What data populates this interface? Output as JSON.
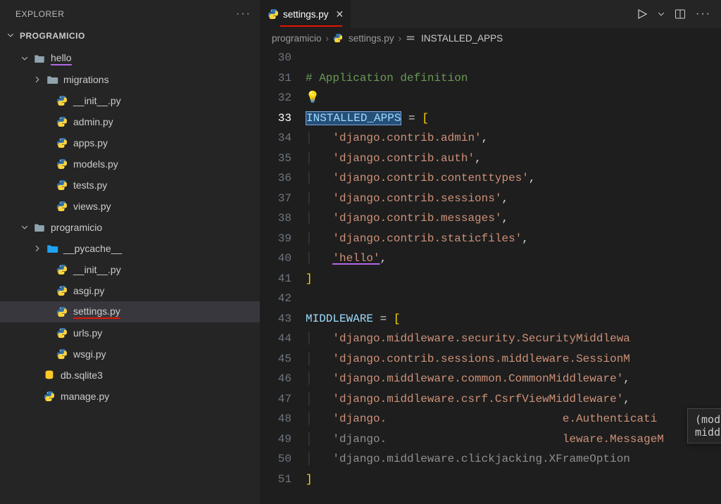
{
  "sidebar": {
    "title": "EXPLORER",
    "root": "PROGRAMICIO",
    "items": [
      {
        "name": "hello",
        "kind": "folder",
        "indent": 0,
        "open": true,
        "hl": "purple"
      },
      {
        "name": "migrations",
        "kind": "folder",
        "indent": 1,
        "open": false
      },
      {
        "name": "__init__.py",
        "kind": "py",
        "indent": 2
      },
      {
        "name": "admin.py",
        "kind": "py",
        "indent": 2
      },
      {
        "name": "apps.py",
        "kind": "py",
        "indent": 2
      },
      {
        "name": "models.py",
        "kind": "py",
        "indent": 2
      },
      {
        "name": "tests.py",
        "kind": "py",
        "indent": 2
      },
      {
        "name": "views.py",
        "kind": "py",
        "indent": 2
      },
      {
        "name": "programicio",
        "kind": "folder",
        "indent": 0,
        "open": true
      },
      {
        "name": "__pycache__",
        "kind": "pyfolder",
        "indent": 1,
        "open": false
      },
      {
        "name": "__init__.py",
        "kind": "py",
        "indent": 2
      },
      {
        "name": "asgi.py",
        "kind": "py",
        "indent": 2
      },
      {
        "name": "settings.py",
        "kind": "py",
        "indent": 2,
        "active": true,
        "hl": "red"
      },
      {
        "name": "urls.py",
        "kind": "py",
        "indent": 2
      },
      {
        "name": "wsgi.py",
        "kind": "py",
        "indent": 2
      },
      {
        "name": "db.sqlite3",
        "kind": "db",
        "indent": 1
      },
      {
        "name": "manage.py",
        "kind": "py",
        "indent": 1
      }
    ]
  },
  "tab": {
    "label": "settings.py"
  },
  "breadcrumb": {
    "segments": [
      "programicio",
      "settings.py",
      "INSTALLED_APPS"
    ]
  },
  "tooltip": {
    "kind": "(module)",
    "name": "middleware"
  },
  "code": {
    "first_line_no": 30,
    "current_line_no": 33,
    "lines": [
      {
        "t": "blank"
      },
      {
        "t": "comment",
        "text": "# Application definition"
      },
      {
        "t": "bulb"
      },
      {
        "t": "assign_open",
        "var": "INSTALLED_APPS",
        "sel": true
      },
      {
        "t": "string_item",
        "text": "'django.contrib.admin'",
        "comma": true
      },
      {
        "t": "string_item",
        "text": "'django.contrib.auth'",
        "comma": true
      },
      {
        "t": "string_item",
        "text": "'django.contrib.contenttypes'",
        "comma": true
      },
      {
        "t": "string_item",
        "text": "'django.contrib.sessions'",
        "comma": true
      },
      {
        "t": "string_item",
        "text": "'django.contrib.messages'",
        "comma": true
      },
      {
        "t": "string_item",
        "text": "'django.contrib.staticfiles'",
        "comma": true
      },
      {
        "t": "string_item",
        "text": "'hello'",
        "comma": true,
        "hl": "purple"
      },
      {
        "t": "close_bracket"
      },
      {
        "t": "blank"
      },
      {
        "t": "assign_open",
        "var": "MIDDLEWARE"
      },
      {
        "t": "string_item",
        "text": "'django.middleware.security.SecurityMiddlewa",
        "comma": false
      },
      {
        "t": "string_item",
        "text": "'django.contrib.sessions.middleware.SessionM",
        "comma": false
      },
      {
        "t": "string_item",
        "text": "'django.middleware.common.CommonMiddleware'",
        "comma": true
      },
      {
        "t": "string_item",
        "text": "'django.middleware.csrf.CsrfViewMiddleware'",
        "comma": true
      },
      {
        "t": "string_item_obscured",
        "left": "'django.",
        "right": "e.Authenticati"
      },
      {
        "t": "string_item_obscured2",
        "left": "'django.",
        "right": "leware.MessageM"
      },
      {
        "t": "string_item",
        "text": "'django.middleware.clickjacking.XFrameOption",
        "comma": false,
        "dim": true
      },
      {
        "t": "close_bracket"
      }
    ]
  }
}
